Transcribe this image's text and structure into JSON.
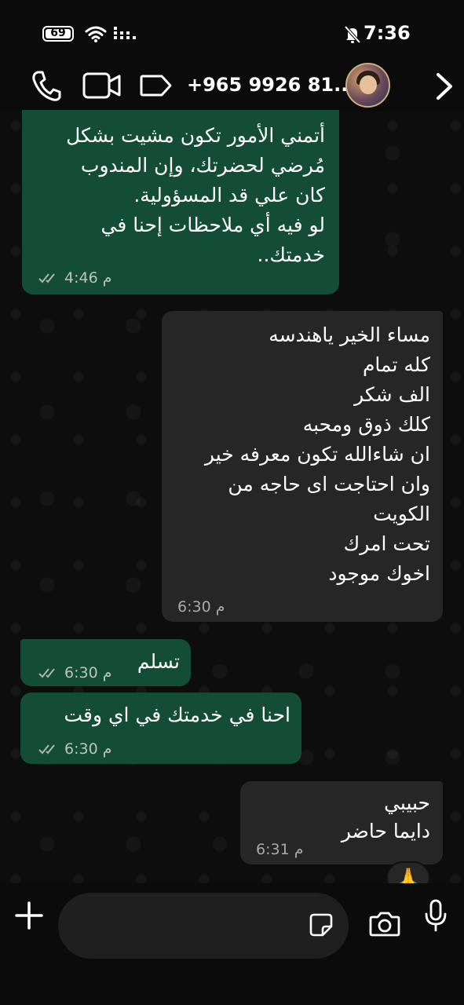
{
  "status_bar": {
    "battery": "69",
    "time": "7:36"
  },
  "header": {
    "contact": "+965 9926 81..."
  },
  "messages": [
    {
      "direction": "out",
      "text": "أتمني الأمور تكون مشيت بشكل\nمُرضي لحضرتك، وإن المندوب\nكان علي قد المسؤولية.\nلو فيه أي ملاحظات إحنا في\nخدمتك..",
      "time": "4:46 م",
      "status": "read"
    },
    {
      "direction": "in",
      "text": "مساء الخير ياهندسه\nكله تمام\nالف شكر\nكلك ذوق ومحبه\nان شاءالله تكون معرفه خير\nوان احتاجت اى حاجه من\nالكويت\nتحت امرك\nاخوك موجود",
      "time": "6:30 م"
    },
    {
      "direction": "out",
      "text": "تسلم",
      "time": "6:30 م",
      "status": "read"
    },
    {
      "direction": "out",
      "text": "احنا في خدمتك في اي وقت",
      "time": "6:30 م",
      "status": "read"
    },
    {
      "direction": "in",
      "text": "حبيبي\nدايما حاضر",
      "time": "6:31 م",
      "reaction": "🙏"
    }
  ],
  "input": {
    "placeholder": ""
  },
  "icons": {
    "status": [
      "battery-icon",
      "wifi-icon",
      "signal-icon",
      "mute-icon"
    ],
    "header": [
      "phone-icon",
      "video-call-icon",
      "label-icon",
      "avatar",
      "chevron-right-icon"
    ],
    "input_bar": [
      "plus-icon",
      "sticker-icon",
      "camera-icon",
      "mic-icon"
    ]
  },
  "colors": {
    "outgoing_bubble": "#134d37",
    "incoming_bubble": "#262626",
    "background": "#0b0b0b"
  }
}
